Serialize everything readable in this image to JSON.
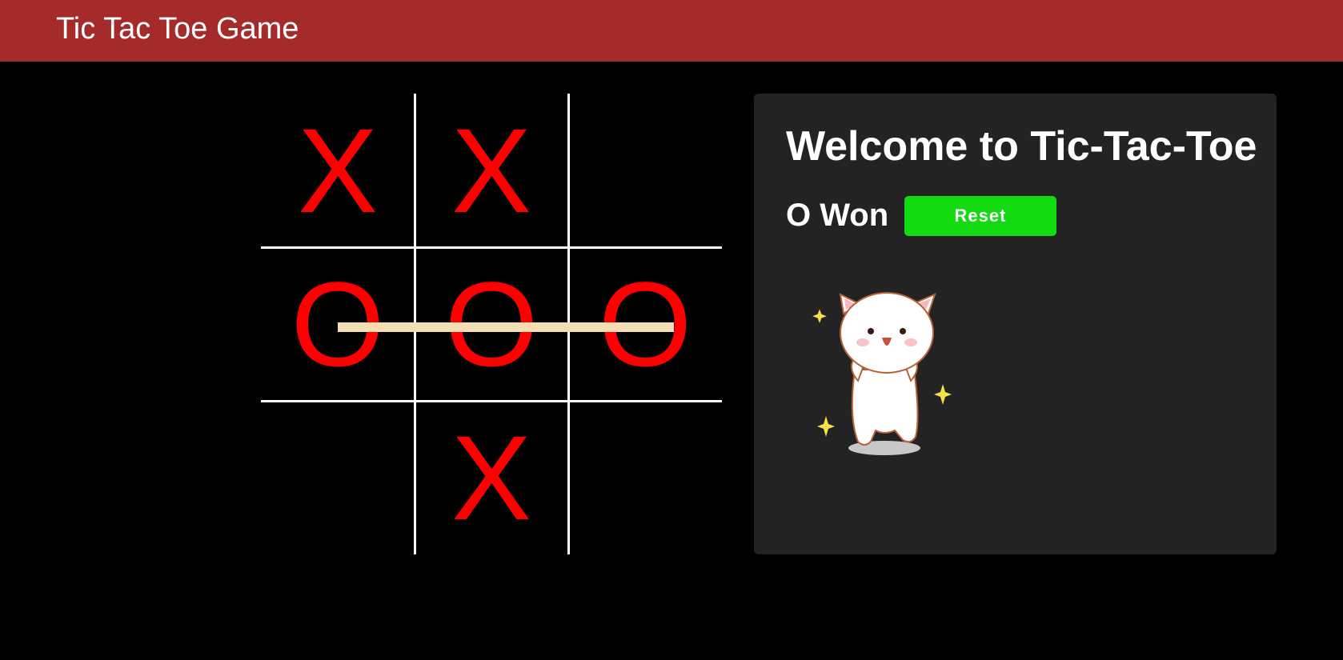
{
  "navbar": {
    "title": "Tic Tac Toe Game"
  },
  "board": {
    "cells": [
      "X",
      "X",
      "",
      "O",
      "O",
      "O",
      "",
      "X",
      ""
    ],
    "winning_row": 1
  },
  "panel": {
    "heading": "Welcome to Tic-Tac-Toe",
    "status": "O Won",
    "reset_label": "Reset"
  },
  "colors": {
    "navbar": "#a52a2a",
    "mark": "#ff0000",
    "win_line": "#f5deb3",
    "panel_bg": "#232323",
    "reset_bg": "#12db12"
  },
  "icons": {
    "celebration": "celebrating-cat-sticker"
  }
}
